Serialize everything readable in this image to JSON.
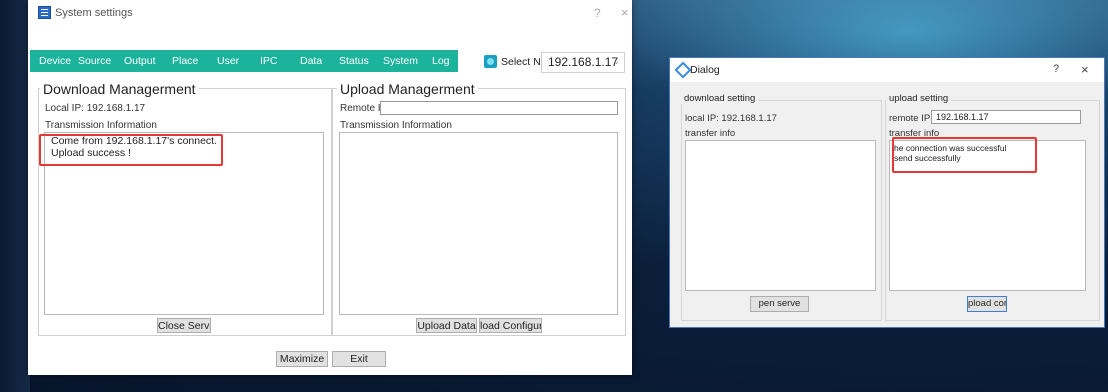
{
  "settings_window": {
    "title": "System settings",
    "help": "?",
    "close": "×",
    "nav": [
      "Device",
      "Source",
      "Output",
      "Place",
      "User",
      "IPC",
      "Data",
      "Status",
      "System",
      "Log"
    ],
    "select_nic_label": "Select NIC",
    "nic_value": "192.168.1.17",
    "nic_arrow": "⌄",
    "download": {
      "title": "Download Managerment",
      "local_ip": "Local IP: 192.168.1.17",
      "transmission_label": "Transmission Information",
      "lines": [
        "Come from 192.168.1.17's connect.",
        "Upload success !"
      ],
      "close_server_button": "Close Server"
    },
    "upload": {
      "title": "Upload Managerment",
      "remote_ip_label": "Remote IP:",
      "remote_ip_value": "",
      "transmission_label": "Transmission Information",
      "upload_data_button": "Upload Data",
      "load_config_button": "load Configurati"
    },
    "maximize_button": "Maximize",
    "exit_button": "Exit"
  },
  "dialog": {
    "title": "Dialog",
    "help": "?",
    "close": "×",
    "download": {
      "title": "download setting",
      "local_ip": "local IP: 192.168.1.17",
      "transfer_label": "transfer info",
      "open_server_button": "pen serve"
    },
    "upload": {
      "title": "upload setting",
      "remote_ip_label": "remote IP:",
      "remote_ip_value": "192.168.1.17",
      "transfer_label": "transfer info",
      "lines": [
        "he connection was successful",
        "send successfully"
      ],
      "upload_conf_button": "pload conf"
    }
  },
  "colors": {
    "nav_bar": "#1bb39c",
    "highlight": "#e53935"
  }
}
